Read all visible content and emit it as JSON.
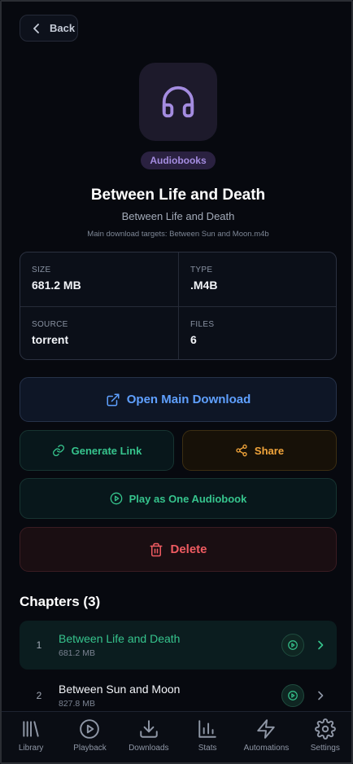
{
  "back_label": "Back",
  "category": "Audiobooks",
  "title": "Between Life and Death",
  "subtitle": "Between Life and Death",
  "targets": "Main download targets: Between Sun and Moon.m4b",
  "stats": {
    "size_label": "SIZE",
    "size_value": "681.2 MB",
    "type_label": "TYPE",
    "type_value": ".M4B",
    "source_label": "SOURCE",
    "source_value": "torrent",
    "files_label": "FILES",
    "files_value": "6"
  },
  "actions": {
    "open": "Open Main Download",
    "generate": "Generate Link",
    "share": "Share",
    "play_all": "Play as One Audiobook",
    "delete": "Delete"
  },
  "chapters_title": "Chapters (3)",
  "chapters": [
    {
      "num": "1",
      "name": "Between Life and Death",
      "size": "681.2 MB"
    },
    {
      "num": "2",
      "name": "Between Sun and Moon",
      "size": "827.8 MB"
    }
  ],
  "nav": [
    {
      "label": "Library",
      "icon": "library-icon"
    },
    {
      "label": "Playback",
      "icon": "play-circle-icon"
    },
    {
      "label": "Downloads",
      "icon": "download-icon"
    },
    {
      "label": "Stats",
      "icon": "bar-chart-icon"
    },
    {
      "label": "Automations",
      "icon": "lightning-icon"
    },
    {
      "label": "Settings",
      "icon": "gear-icon"
    }
  ],
  "colors": {
    "accent_purple": "#a48ce0",
    "accent_blue": "#5fa0ff",
    "accent_green": "#36c48d",
    "accent_orange": "#f2a53b",
    "accent_red": "#ef5b61",
    "background": "#07090f"
  }
}
